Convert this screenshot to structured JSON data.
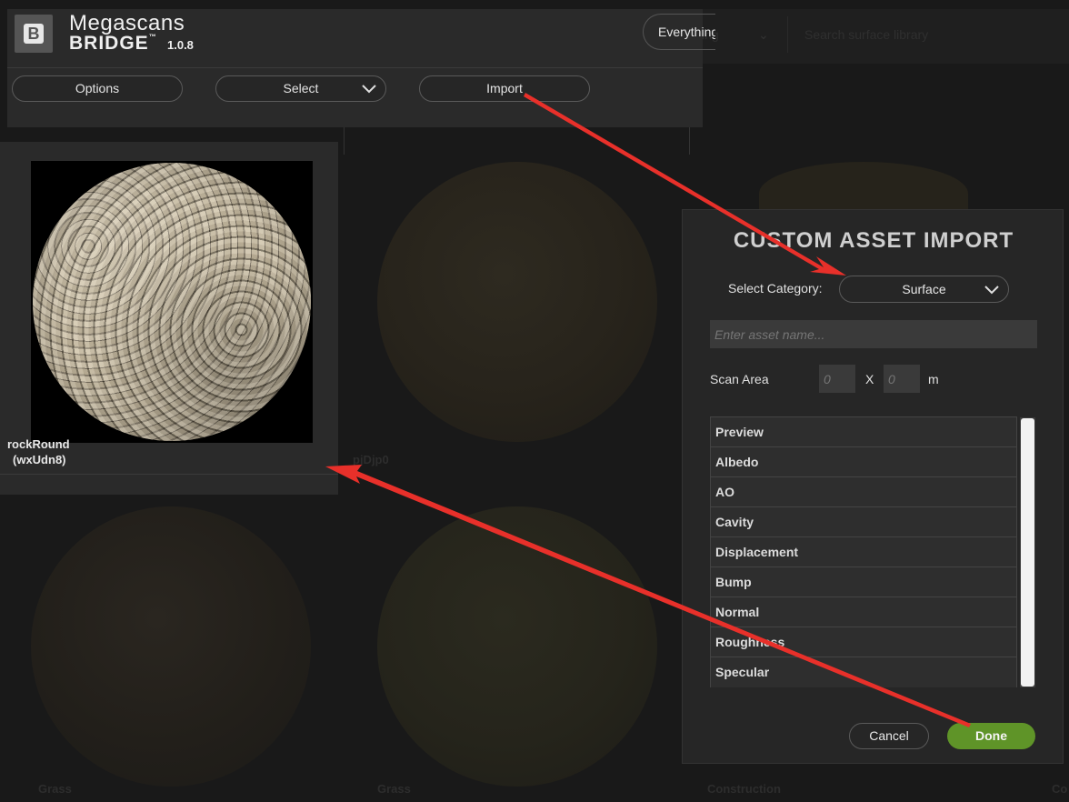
{
  "app": {
    "brand_name": "Megascans",
    "brand_sub": "BRIDGE",
    "trademark": "™",
    "version": "1.0.8",
    "filter_label": "Everything",
    "search_placeholder": "Search surface library"
  },
  "toolbar": {
    "options_label": "Options",
    "select_label": "Select",
    "import_label": "Import"
  },
  "assets": {
    "selected": {
      "name": "rockRound",
      "id": "(wxUdn8)"
    },
    "background_labels": [
      "pjDjp0",
      "Grass",
      "Grass",
      "Construction",
      "Co"
    ]
  },
  "dialog": {
    "title": "CUSTOM ASSET IMPORT",
    "category_label": "Select Category:",
    "category_value": "Surface",
    "name_placeholder": "Enter asset name...",
    "scan_area_label": "Scan Area",
    "scan_x_placeholder": "0",
    "scan_y_placeholder": "0",
    "scan_separator": "X",
    "scan_unit": "m",
    "maps": [
      "Preview",
      "Albedo",
      "AO",
      "Cavity",
      "Displacement",
      "Bump",
      "Normal",
      "Roughness",
      "Specular"
    ],
    "cancel_label": "Cancel",
    "done_label": "Done"
  },
  "colors": {
    "done_green": "#5f9428",
    "annotation_red": "#e8302a"
  }
}
